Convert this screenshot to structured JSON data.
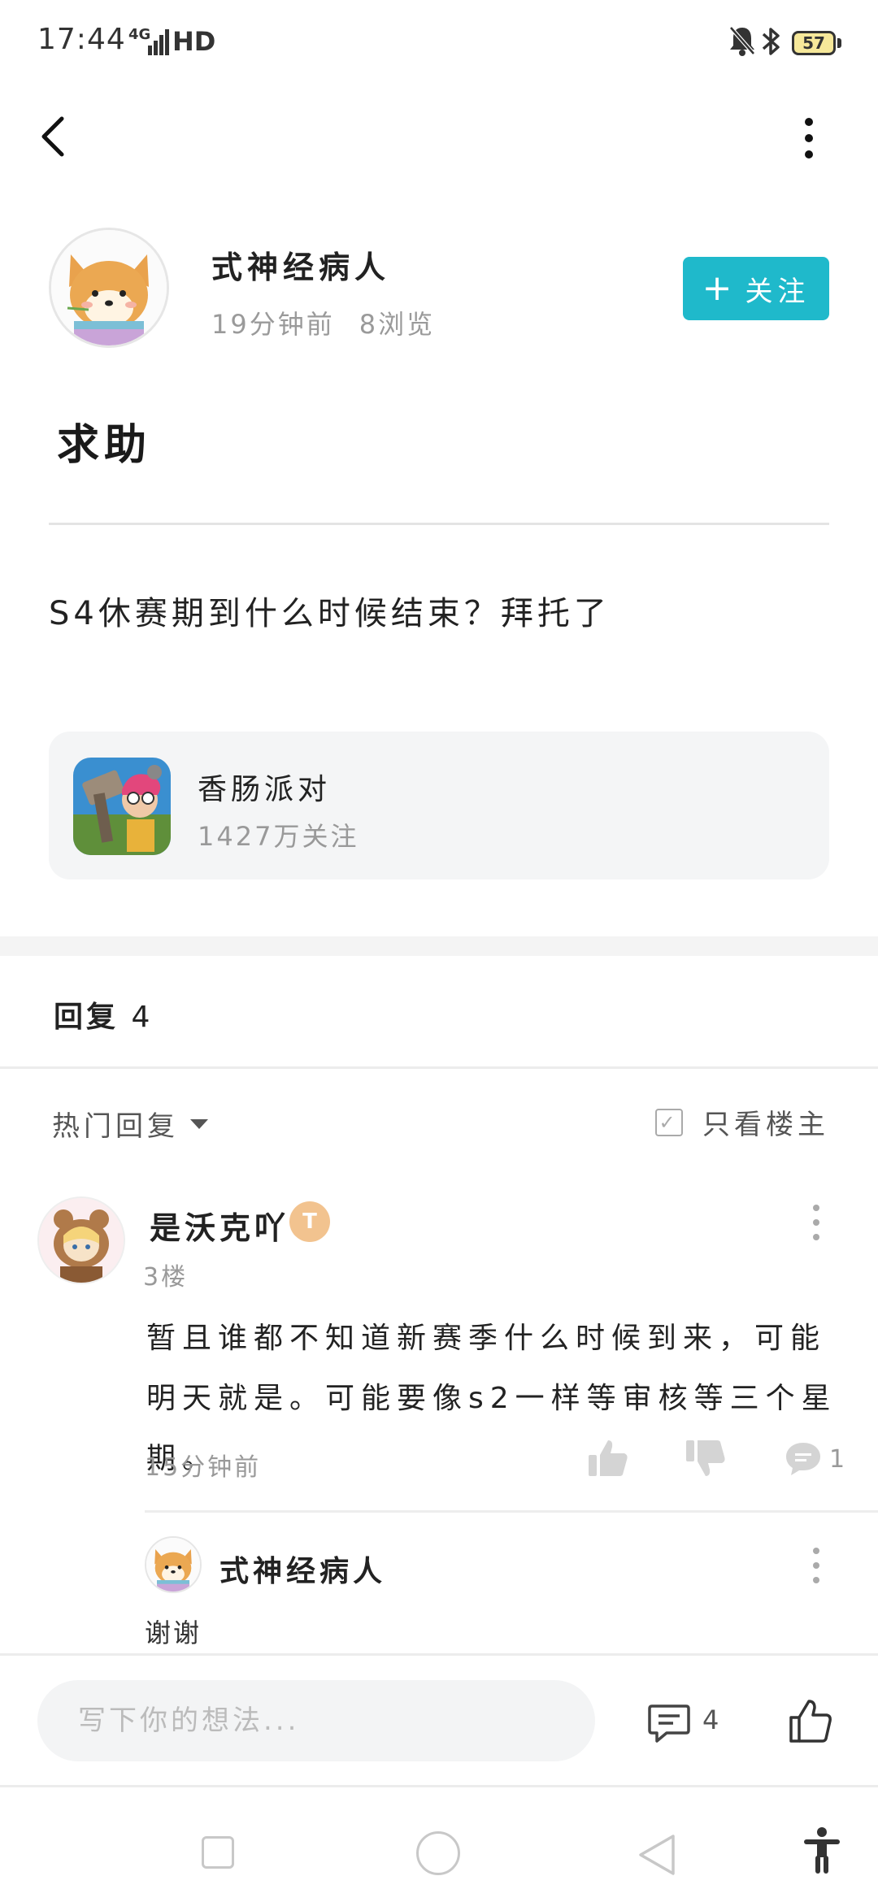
{
  "status_bar": {
    "time": "17:44",
    "network": "4G",
    "hd": "HD",
    "battery": "57"
  },
  "icons": {
    "back": "chevron-left-icon",
    "more": "more-vertical-icon",
    "mute": "bell-off-icon",
    "bluetooth": "bluetooth-icon",
    "thumbs_up": "thumbs-up-icon",
    "thumbs_down": "thumbs-down-icon",
    "comment": "comment-icon"
  },
  "colors": {
    "accent": "#1fb9cb",
    "battery": "#f6e89a"
  },
  "post": {
    "author": "式神经病人",
    "time_ago": "19分钟前",
    "views": "8浏览",
    "follow_label": "关注",
    "title": "求助",
    "body": "S4休赛期到什么时候结束？拜托了"
  },
  "game_card": {
    "name": "香肠派对",
    "followers": "1427万关注"
  },
  "replies": {
    "label": "回复",
    "count": "4",
    "sort_label": "热门回复",
    "only_op_label": "只看楼主",
    "items": [
      {
        "name": "是沃克吖",
        "badge": "T",
        "floor": "3楼",
        "body": "暂且谁都不知道新赛季什么时候到来，可能明天就是。可能要像s2一样等审核等三个星期。",
        "time": "15分钟前",
        "comment_count": "1",
        "sub_replies": [
          {
            "name": "式神经病人",
            "body": "谢谢"
          }
        ]
      }
    ]
  },
  "bottom_bar": {
    "input_placeholder": "写下你的想法...",
    "comment_count": "4"
  }
}
